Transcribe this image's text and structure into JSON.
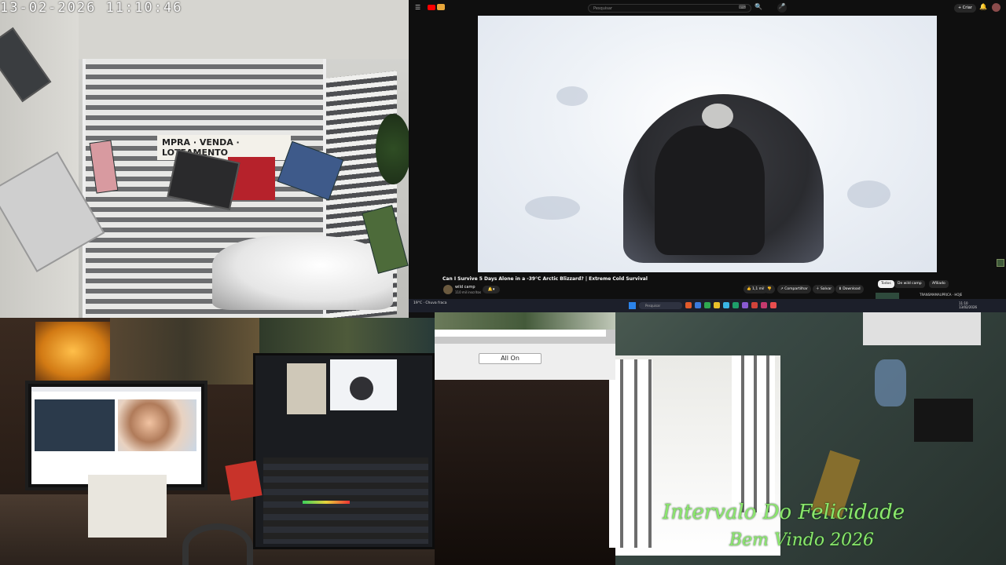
{
  "camera": {
    "timestamp": "13-02-2026  11:10:46",
    "sign_text": "MPRA · VENDA · LOTEAMENTO"
  },
  "browser": {
    "search_placeholder": "Pesquisar",
    "create_label": "+ Criar",
    "video": {
      "title": "Can I Survive 5 Days Alone in a -39°C Arctic Blizzard? | Extreme Cold Survival",
      "channel": "wild camp",
      "subscribers": "110 mil inscritos",
      "actions": [
        "1,1 mil",
        "Compartilhar",
        "Salvar",
        "Download"
      ],
      "chips": [
        "Todos",
        "De wild camp",
        "Afiliado"
      ],
      "side_item": "TRANSMAMAUPRICA · HOJE"
    }
  },
  "taskbar": {
    "weather": "19°C · Chuva fraca",
    "search_placeholder": "Pesquisar",
    "time": "11:10",
    "date": "13/02/2026"
  },
  "dialog": {
    "all_on_label": "All On"
  },
  "overlay": {
    "caption_line1": "Intervalo Do Felicidade",
    "caption_line2": "Bem Vindo 2026",
    "caption_color": "#8be86c"
  },
  "icons": {
    "menu": "☰",
    "search": "🔍",
    "mic": "🎤",
    "bell": "🔔",
    "like": "👍",
    "dislike": "👎",
    "share": "↗",
    "save": "＋",
    "download": "⬇"
  }
}
